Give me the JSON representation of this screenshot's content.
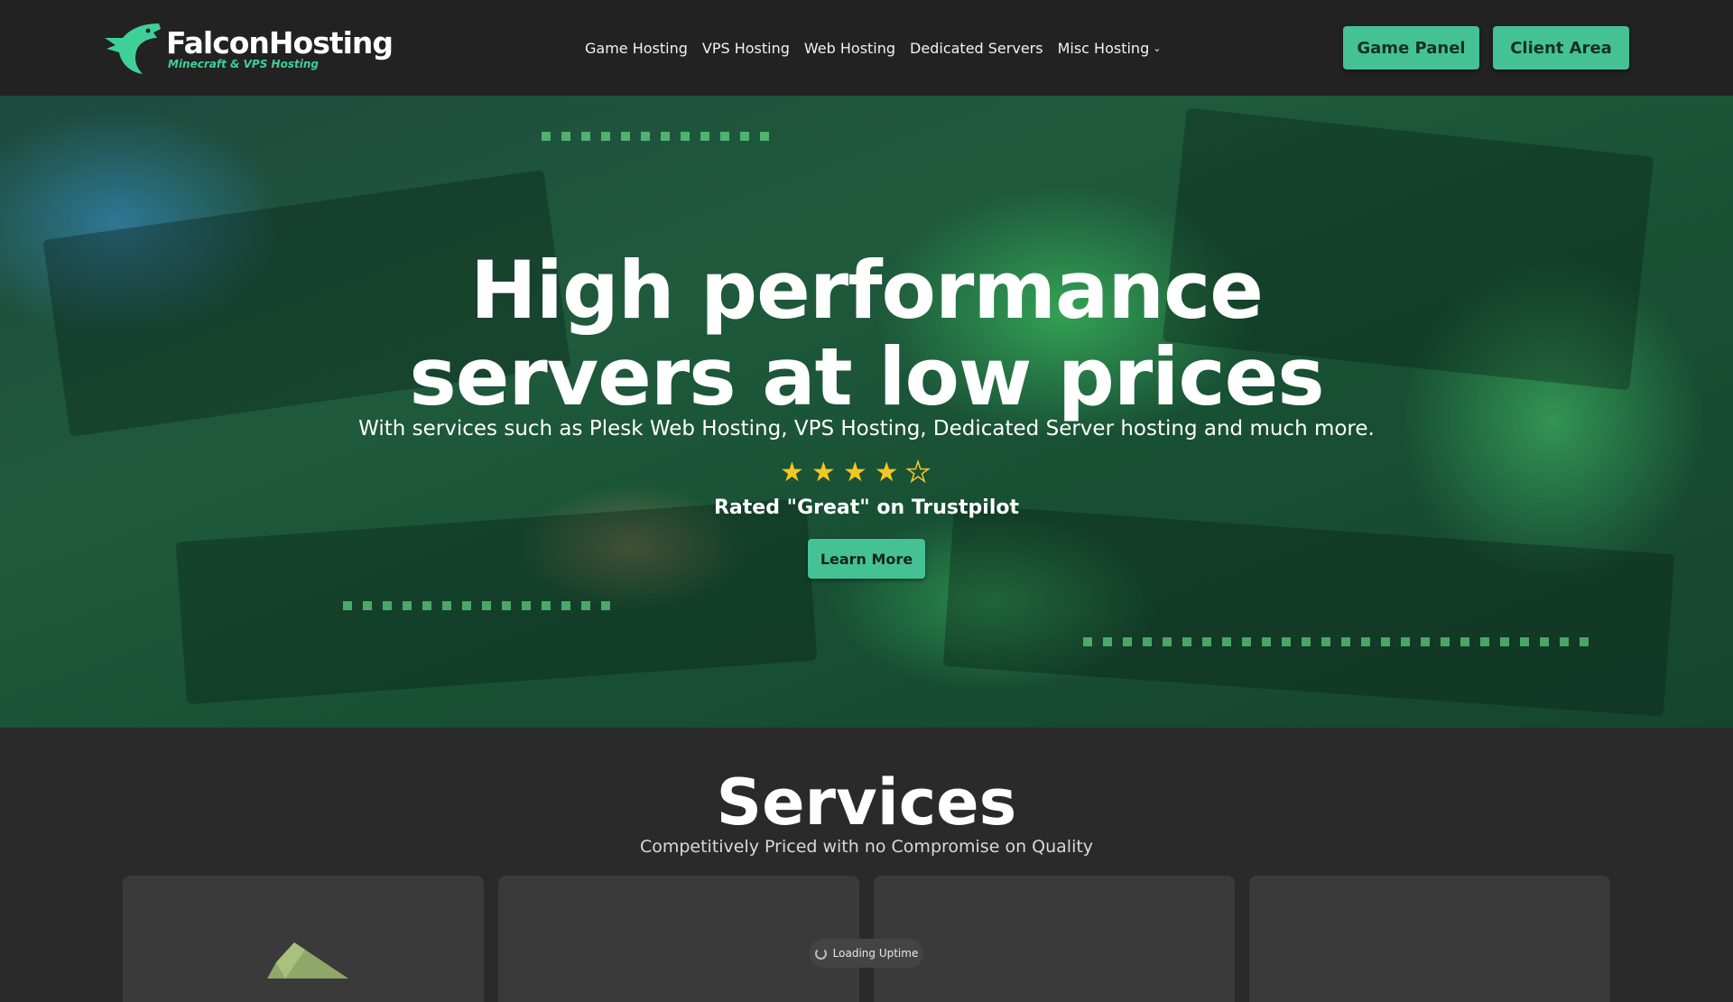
{
  "brand": {
    "name": "FalconHosting",
    "tagline": "Minecraft & VPS Hosting",
    "accent": "#45c295"
  },
  "nav": {
    "items": [
      {
        "label": "Game Hosting"
      },
      {
        "label": "VPS Hosting"
      },
      {
        "label": "Web Hosting"
      },
      {
        "label": "Dedicated Servers"
      },
      {
        "label": "Misc Hosting",
        "icon": "chevron-down-icon"
      }
    ]
  },
  "header": {
    "game_panel": "Game Panel",
    "client_area": "Client Area"
  },
  "hero": {
    "title_line1": "High performance",
    "title_line2": "servers at low prices",
    "subtitle": "With services such as Plesk Web Hosting, VPS Hosting, Dedicated Server hosting and much more.",
    "rating_stars": 4,
    "rating_max": 5,
    "rating_text": "Rated \"Great\" on Trustpilot",
    "cta": "Learn More"
  },
  "services": {
    "title": "Services",
    "subtitle": "Competitively Priced with no Compromise on Quality"
  },
  "status": {
    "uptime_label": "Loading Uptime"
  }
}
